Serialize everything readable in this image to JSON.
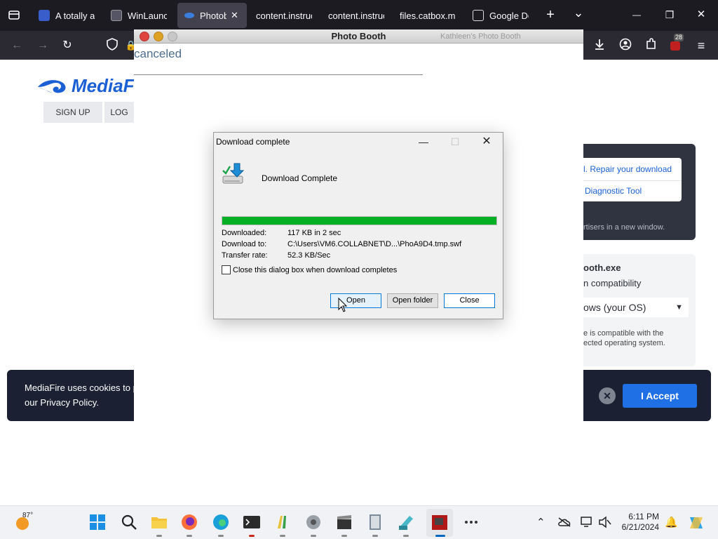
{
  "browser": {
    "tabs": [
      {
        "label": "A totally ac",
        "color": "#3a5dcc"
      },
      {
        "label": "WinLaunch",
        "color": "#555566"
      },
      {
        "label": "Photobo",
        "color": "#3b7ddd"
      },
      {
        "label": "content.instruc",
        "color": ""
      },
      {
        "label": "content.instruc",
        "color": ""
      },
      {
        "label": "files.catbox.mo",
        "color": ""
      },
      {
        "label": "Google Dev",
        "color": "#dddddd"
      }
    ],
    "new_tab": "+",
    "tab_list": "⌄",
    "minimize": "—",
    "restore": "❐",
    "close": "✕",
    "extensions_badge": "28"
  },
  "page": {
    "logo_text": "MediaF",
    "nav": {
      "signup": "SIGN UP",
      "login": "LOG"
    },
    "right_panel": {
      "link1": "l. Repair your download",
      "link2": "Diagnostic Tool",
      "ad_note": "rtisers in a new window."
    },
    "right_panel2": {
      "title": "ooth.exe",
      "subtitle": "n compatibility",
      "select_value": "ows (your OS)",
      "note1": "e is compatible with the",
      "note2": "ected operating system."
    },
    "cookie": {
      "text1": "MediaFire uses cookies to p",
      "text2": "our Privacy Policy.",
      "dismiss": "✕",
      "accept": "I Accept"
    }
  },
  "photo_booth": {
    "title": "Photo Booth",
    "subtitle": "Kathleen's Photo Booth",
    "status": "canceled",
    "traffic": {
      "close": "#e0443e",
      "minimize": "#dea123",
      "maximize": "#c8c8c8"
    }
  },
  "dialog": {
    "title": "Download complete",
    "message": "Download Complete",
    "progress": 1.0,
    "downloaded_label": "Downloaded:",
    "downloaded_value": "117 KB in 2 sec",
    "download_to_label": "Download to:",
    "download_to_value": "C:\\Users\\VM6.COLLABNET\\D...\\PhoA9D4.tmp.swf",
    "transfer_label": "Transfer rate:",
    "transfer_value": "52.3 KB/Sec",
    "checkbox_label": "Close this dialog box when download completes",
    "checkbox_checked": false,
    "buttons": {
      "open": "Open",
      "open_folder": "Open folder",
      "close": "Close"
    }
  },
  "taskbar": {
    "temperature": "87°",
    "time": "6:11 PM",
    "date": "6/21/2024",
    "app_icons": [
      "windows-start-icon",
      "search-icon",
      "file-explorer-icon",
      "firefox-icon",
      "edge-icon",
      "terminal-icon",
      "paint-brush-icon",
      "media-icon",
      "clapperboard-icon",
      "book-icon",
      "notepad-icon",
      "photo-booth-icon",
      "more-apps-icon"
    ]
  }
}
